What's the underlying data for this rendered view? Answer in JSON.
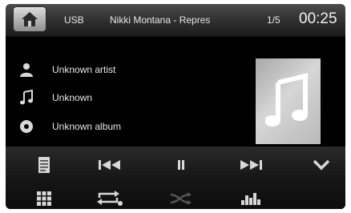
{
  "topbar": {
    "source": "USB",
    "track_title": "Nikki Montana - Repres",
    "track_index": "1/5",
    "clock": "00:25"
  },
  "info": {
    "artist": "Unknown artist",
    "title": "Unknown",
    "album": "Unknown album"
  },
  "icons": {
    "home": "home-icon",
    "artist": "person-icon",
    "title": "music-note-icon",
    "album": "disc-icon",
    "list": "file-list-icon",
    "prev": "skip-previous-icon",
    "pause": "pause-icon",
    "next": "skip-next-icon",
    "collapse": "chevron-down-icon",
    "menu": "grid-menu-icon",
    "repeat": "repeat-icon",
    "shuffle": "shuffle-icon",
    "eq": "equalizer-icon"
  },
  "colors": {
    "background": "#000000",
    "text": "#e6e6e6",
    "icon": "#d8d8d8"
  }
}
